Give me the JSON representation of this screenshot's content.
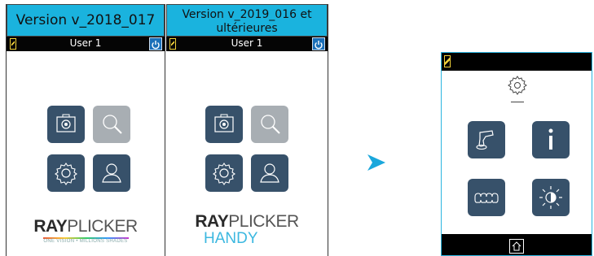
{
  "left_panel": {
    "title": "Version v_2018_017",
    "user": "User 1",
    "logo_ray": "RAY",
    "logo_plicker": "PLICKER",
    "tagline": "ONE VISION • MILLIONS SHADES"
  },
  "right_panel": {
    "title": "Version v_2019_016 et ultérieures",
    "user": "User 1",
    "logo_ray": "RAY",
    "logo_plicker": "PLICKER",
    "logo_handy": "HANDY"
  },
  "icons": {
    "camera": "camera-icon",
    "search": "search-icon",
    "settings": "gear-icon",
    "user": "user-icon",
    "scanner": "scanner-icon",
    "info": "info-icon",
    "teeth": "teeth-icon",
    "brightness": "brightness-icon",
    "home": "home-icon",
    "power": "power-icon",
    "battery": "battery-icon",
    "arrow": "arrow-right-icon"
  },
  "colors": {
    "header": "#1ab3de",
    "tile": "#37516a",
    "tile_disabled": "#a8aeb3",
    "arrow": "#1aa7dc",
    "device_border": "#2bb5e0"
  }
}
